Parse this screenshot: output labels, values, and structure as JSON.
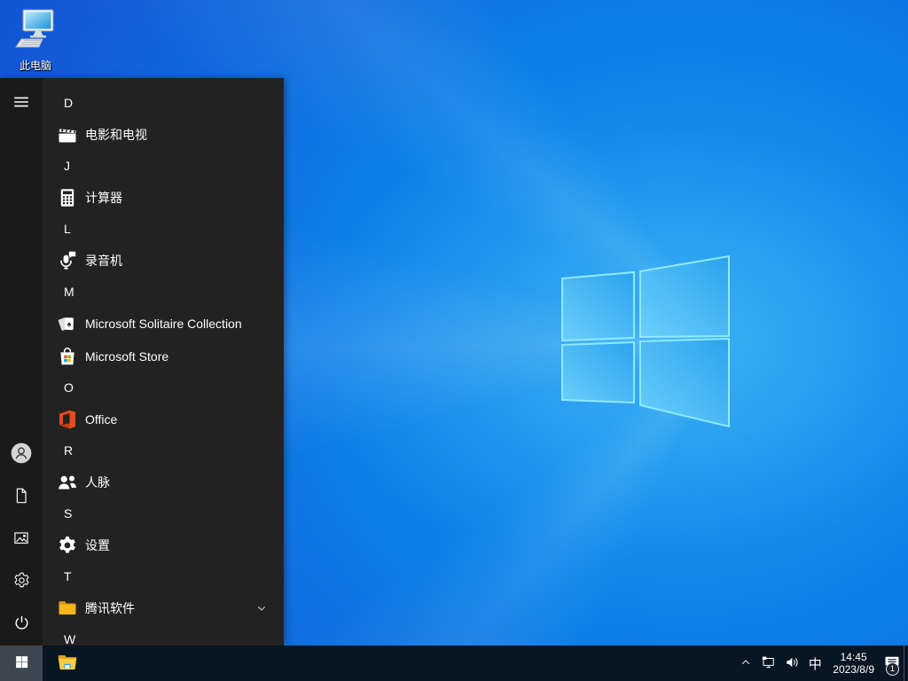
{
  "colors": {
    "wp-base": "#1546c2",
    "wp-glow": "#23a3f2",
    "menu-bg": "#222222",
    "rail-bg": "#1a1a1a",
    "taskbar-bg": "#081522",
    "start-btn-bg": "#3b4650",
    "logo-fill": "#3fb6f5",
    "logo-edge": "#8feaff"
  },
  "desktop": {
    "this_pc_label": "此电脑"
  },
  "start_menu": {
    "rail_top": [
      {
        "name": "expand-menu",
        "icon": "menu"
      }
    ],
    "rail_bottom": [
      {
        "name": "user-account",
        "icon": "user"
      },
      {
        "name": "documents",
        "icon": "document"
      },
      {
        "name": "pictures",
        "icon": "pictures"
      },
      {
        "name": "settings",
        "icon": "gear-outline"
      },
      {
        "name": "power",
        "icon": "power"
      }
    ],
    "items": [
      {
        "type": "header",
        "label": "D"
      },
      {
        "type": "app",
        "label": "电影和电视",
        "icon": "movies-tv"
      },
      {
        "type": "header",
        "label": "J"
      },
      {
        "type": "app",
        "label": "计算器",
        "icon": "calculator"
      },
      {
        "type": "header",
        "label": "L"
      },
      {
        "type": "app",
        "label": "录音机",
        "icon": "voice-recorder"
      },
      {
        "type": "header",
        "label": "M"
      },
      {
        "type": "app",
        "label": "Microsoft Solitaire Collection",
        "icon": "solitaire"
      },
      {
        "type": "app",
        "label": "Microsoft Store",
        "icon": "store"
      },
      {
        "type": "header",
        "label": "O"
      },
      {
        "type": "app",
        "label": "Office",
        "icon": "office"
      },
      {
        "type": "header",
        "label": "R"
      },
      {
        "type": "app",
        "label": "人脉",
        "icon": "people"
      },
      {
        "type": "header",
        "label": "S"
      },
      {
        "type": "app",
        "label": "设置",
        "icon": "gear-filled"
      },
      {
        "type": "header",
        "label": "T"
      },
      {
        "type": "app",
        "label": "腾讯软件",
        "icon": "folder",
        "expandable": true
      },
      {
        "type": "header",
        "label": "W"
      }
    ]
  },
  "taskbar": {
    "tray": {
      "ime": "中",
      "time": "14:45",
      "date": "2023/8/9",
      "notification_count": "1"
    }
  }
}
